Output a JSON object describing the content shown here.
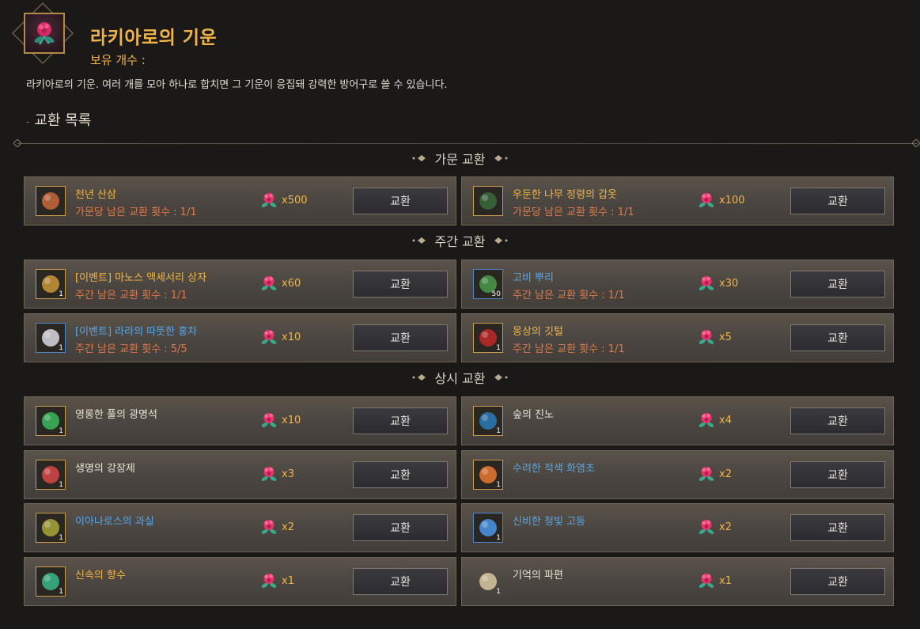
{
  "header": {
    "title": "라키아로의 기운",
    "owned_label": "보유 개수 :",
    "description": "라키아로의 기운. 여러 개를 모아 하나로 합치면 그 기운이 응집돼 강력한 방어구로 쓸 수 있습니다.",
    "section_title": "교환 목록",
    "section_dash": "-",
    "icon": "flower-icon"
  },
  "button_label": "교환",
  "categories": {
    "family": "가문 교환",
    "weekly": "주간 교환",
    "always": "상시 교환"
  },
  "items": {
    "family": [
      {
        "name": "천년 산삼",
        "limit": "가문당 남은 교환 횟수 : 1/1",
        "cost": "x500",
        "icon": "ginseng-icon"
      },
      {
        "name": "우둔한 나무 정령의 갑옷",
        "limit": "가문당 남은 교환 횟수 : 1/1",
        "cost": "x100",
        "icon": "tree-armor-icon"
      }
    ],
    "weekly": [
      {
        "name": "[이벤트] 마노스 액세서리 상자",
        "limit": "주간 남은 교환 횟수 : 1/1",
        "cost": "x60",
        "icon": "treasure-chest-icon",
        "qty": "1"
      },
      {
        "name": "고비 뿌리",
        "limit": "주간 남은 교환 횟수 : 1/1",
        "cost": "x30",
        "icon": "fern-root-icon",
        "qty": "50"
      },
      {
        "name": "[이벤트] 라라의 따뜻한 홍차",
        "limit": "주간 남은 교환 횟수 : 5/5",
        "cost": "x10",
        "icon": "tea-cup-icon",
        "qty": "1"
      },
      {
        "name": "몽상의 깃털",
        "limit": "주간 남은 교환 횟수 : 1/1",
        "cost": "x5",
        "icon": "feather-icon",
        "qty": "1"
      }
    ],
    "always": [
      {
        "name": "영롱한 풀의 광명석",
        "cost": "x10",
        "icon": "green-gem-icon",
        "qty": "1"
      },
      {
        "name": "숲의 진노",
        "cost": "x4",
        "icon": "forest-wrath-icon",
        "qty": "1"
      },
      {
        "name": "생명의 강장제",
        "cost": "x3",
        "icon": "potion-icon",
        "qty": "1"
      },
      {
        "name": "수려한 적색 화염초",
        "cost": "x2",
        "icon": "fire-herb-icon",
        "qty": "1"
      },
      {
        "name": "이아나로스의 과실",
        "cost": "x2",
        "icon": "fruit-icon",
        "qty": "1"
      },
      {
        "name": "신비한 청빛 고둥",
        "cost": "x2",
        "icon": "conch-icon",
        "qty": "1"
      },
      {
        "name": "신속의 향수",
        "cost": "x1",
        "icon": "perfume-icon",
        "qty": "1"
      },
      {
        "name": "기억의 파편",
        "cost": "x1",
        "icon": "memory-fragment-icon",
        "qty": "1"
      }
    ]
  },
  "colors": {
    "accent_gold": "#f0b548",
    "limit_orange": "#e07a4a",
    "name_blue": "#56a6e8",
    "currency_pink": "#e83a7a"
  }
}
